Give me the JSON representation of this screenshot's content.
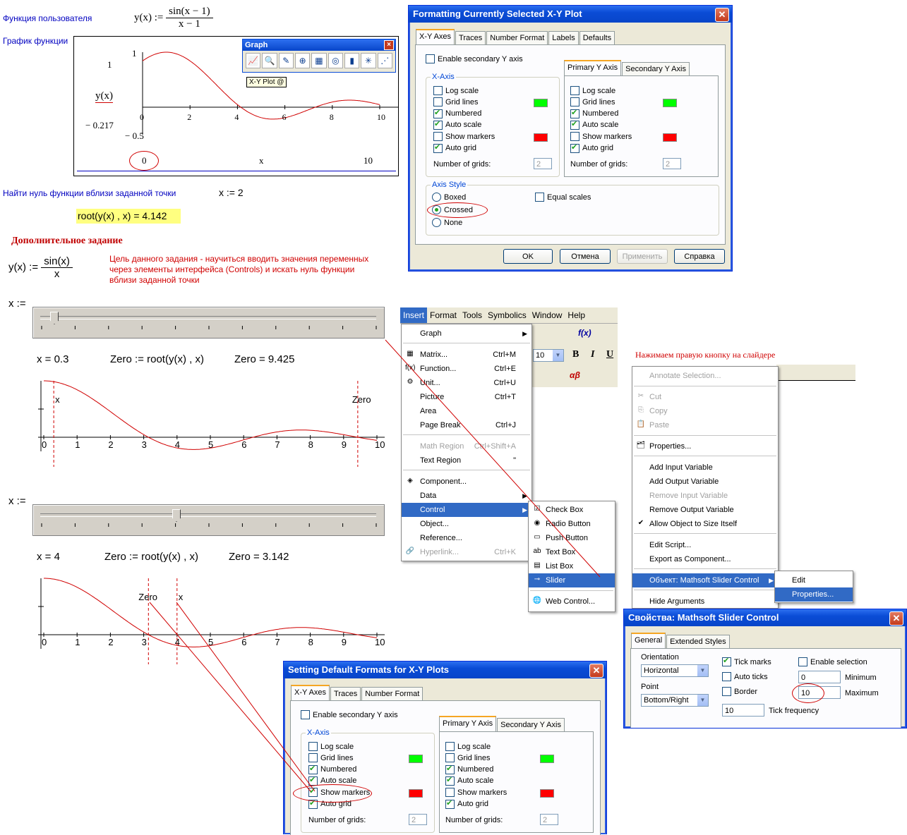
{
  "worksheet": {
    "user_function_label": "Функция пользователя",
    "graph_label": "График функции",
    "find_zero_label": "Найти нуль функции вблизи заданной точки",
    "x_assign": "x := 2",
    "root_result": "root(y(x) , x) = 4.142",
    "additional_task": "Дополнительное задание",
    "task_desc_line1": "Цель данного задания - научиться вводить значения переменных",
    "task_desc_line2": "через элементы интерфейса (Controls) и искать нуль функции",
    "task_desc_line3": "вблизи заданной точки",
    "right_click_note": "Нажимаем правую кнопку на слайдере",
    "y_def1_lhs": "y(x) :=",
    "y_def1_num": "sin(x − 1)",
    "y_def1_den": "x − 1",
    "y_def2_lhs": "y(x) :=",
    "y_def2_num": "sin(x)",
    "y_def2_den": "x",
    "x_slider_label1": "x :=",
    "x_slider_label2": "x :=",
    "row1_x": "x = 0.3",
    "row1_zero_def": "Zero := root(y(x) , x)",
    "row1_zero_val": "Zero = 9.425",
    "row2_x": "x = 4",
    "row2_zero_def": "Zero := root(y(x) , x)",
    "row2_zero_val": "Zero = 3.142"
  },
  "plot1": {
    "y_top": "1",
    "y_bottom": "− 0.5",
    "y_axis_label": "y(x)",
    "y_small": "− 0.217",
    "x_axis_label": "x",
    "x_min": "0",
    "x_max": "10",
    "ticks": [
      "0",
      "2",
      "4",
      "6",
      "8",
      "10"
    ],
    "y_zero": "0",
    "y_upper_tick": "1"
  },
  "graph_toolbar": {
    "title": "Graph",
    "close": "×",
    "tooltip": "X-Y Plot @",
    "icons": [
      "xy-plot-icon",
      "zoom-icon",
      "trace-icon",
      "polar-plot-icon",
      "surface-plot-icon",
      "contour-plot-icon",
      "bar-plot-icon",
      "scatter-plot-icon",
      "vector-field-icon"
    ]
  },
  "plot2": {
    "ticks": [
      "0",
      "1",
      "2",
      "3",
      "4",
      "5",
      "6",
      "7",
      "8",
      "9",
      "10"
    ],
    "marker_x_label": "x",
    "marker_zero_label": "Zero"
  },
  "plot3": {
    "ticks": [
      "0",
      "1",
      "2",
      "3",
      "4",
      "5",
      "6",
      "7",
      "8",
      "9",
      "10"
    ],
    "marker_x_label": "x",
    "marker_zero_label": "Zero"
  },
  "chart_data": [
    {
      "type": "line",
      "title": "",
      "xlabel": "x",
      "ylabel": "y(x)",
      "xlim": [
        0,
        10
      ],
      "ylim": [
        -0.5,
        1
      ],
      "function": "sin(x-1)/(x-1)",
      "x": [
        0,
        1,
        2,
        3,
        4,
        5,
        6,
        7,
        8,
        9,
        10
      ],
      "series": [
        {
          "values": [
            0.841,
            1.0,
            0.841,
            0.455,
            0.047,
            -0.189,
            -0.192,
            -0.047,
            0.094,
            0.124,
            0.046
          ]
        }
      ],
      "grid": false
    },
    {
      "type": "line",
      "xlim": [
        0,
        10
      ],
      "function": "sin(x)/x",
      "x_marker": 0.3,
      "zero_marker": 9.425,
      "x": [
        0,
        1,
        2,
        3,
        4,
        5,
        6,
        7,
        8,
        9,
        10
      ],
      "series": [
        {
          "values": [
            1.0,
            0.841,
            0.455,
            0.047,
            -0.189,
            -0.192,
            -0.047,
            0.094,
            0.124,
            0.046,
            -0.054
          ]
        }
      ]
    },
    {
      "type": "line",
      "xlim": [
        0,
        10
      ],
      "function": "sin(x)/x",
      "x_marker": 4,
      "zero_marker": 3.142,
      "x": [
        0,
        1,
        2,
        3,
        4,
        5,
        6,
        7,
        8,
        9,
        10
      ],
      "series": [
        {
          "values": [
            1.0,
            0.841,
            0.455,
            0.047,
            -0.189,
            -0.192,
            -0.047,
            0.094,
            0.124,
            0.046,
            -0.054
          ]
        }
      ]
    }
  ],
  "fmt_dialog": {
    "title": "Formatting Currently Selected X-Y Plot",
    "tabs": [
      "X-Y Axes",
      "Traces",
      "Number Format",
      "Labels",
      "Defaults"
    ],
    "enable_secondary": "Enable secondary Y axis",
    "x_axis_group": "X-Axis",
    "primary_tab": "Primary Y Axis",
    "secondary_tab": "Secondary Y Axis",
    "options": [
      "Log scale",
      "Grid lines",
      "Numbered",
      "Auto scale",
      "Show markers",
      "Auto grid"
    ],
    "x_checked": [
      false,
      false,
      true,
      true,
      false,
      true
    ],
    "y_checked": [
      false,
      false,
      true,
      true,
      false,
      true
    ],
    "num_grids": "Number of grids:",
    "grids_x": "2",
    "grids_y": "2",
    "axis_style_group": "Axis Style",
    "boxed": "Boxed",
    "crossed": "Crossed",
    "none": "None",
    "equal_scales": "Equal scales",
    "ok": "OK",
    "cancel": "Отмена",
    "apply": "Применить",
    "help": "Справка",
    "grid_color": "#00ff00",
    "marker_color": "#ff0000"
  },
  "default_dialog": {
    "title": "Setting Default Formats for X-Y Plots",
    "tabs": [
      "X-Y Axes",
      "Traces",
      "Number Format"
    ],
    "enable_secondary": "Enable secondary Y axis",
    "x_axis_group": "X-Axis",
    "primary_tab": "Primary Y Axis",
    "secondary_tab": "Secondary Y Axis",
    "options": [
      "Log scale",
      "Grid lines",
      "Numbered",
      "Auto scale",
      "Show markers",
      "Auto grid"
    ],
    "x_checked": [
      false,
      false,
      true,
      true,
      true,
      true
    ],
    "y_checked": [
      false,
      false,
      true,
      true,
      false,
      true
    ],
    "num_grids": "Number of grids:",
    "grids_x": "2",
    "grids_y": "2"
  },
  "menubar": {
    "items": [
      "Insert",
      "Format",
      "Tools",
      "Symbolics",
      "Window",
      "Help"
    ],
    "font_size": "10",
    "bold": "B",
    "italic": "I",
    "underline": "U"
  },
  "insert_menu": {
    "items": [
      {
        "label": "Graph",
        "shortcut": "",
        "submenu": true
      },
      {
        "label": "Matrix...",
        "shortcut": "Ctrl+M"
      },
      {
        "label": "Function...",
        "shortcut": "Ctrl+E"
      },
      {
        "label": "Unit...",
        "shortcut": "Ctrl+U"
      },
      {
        "label": "Picture",
        "shortcut": "Ctrl+T"
      },
      {
        "label": "Area",
        "shortcut": ""
      },
      {
        "label": "Page Break",
        "shortcut": "Ctrl+J"
      },
      {
        "label": "Math Region",
        "shortcut": "Ctrl+Shift+A"
      },
      {
        "label": "Text Region",
        "shortcut": "\""
      },
      {
        "label": "Component...",
        "shortcut": ""
      },
      {
        "label": "Data",
        "shortcut": "",
        "submenu": true
      },
      {
        "label": "Control",
        "shortcut": "",
        "submenu": true
      },
      {
        "label": "Object...",
        "shortcut": ""
      },
      {
        "label": "Reference...",
        "shortcut": ""
      },
      {
        "label": "Hyperlink...",
        "shortcut": "Ctrl+K"
      }
    ]
  },
  "control_submenu": {
    "items": [
      "Check Box",
      "Radio Button",
      "Push Button",
      "Text Box",
      "List Box",
      "Slider",
      "Web Control..."
    ]
  },
  "context_menu": {
    "items": [
      "Annotate Selection...",
      "Cut",
      "Copy",
      "Paste",
      "Properties...",
      "Add Input Variable",
      "Add Output Variable",
      "Remove Input Variable",
      "Remove Output Variable",
      "Allow Object to Size Itself",
      "Edit Script...",
      "Export as Component...",
      "Объект: Mathsoft Slider Control",
      "Hide Arguments"
    ],
    "sub_edit": "Edit",
    "sub_properties": "Properties..."
  },
  "slider_props": {
    "title": "Свойства: Mathsoft Slider Control",
    "tab_general": "General",
    "tab_extended": "Extended Styles",
    "orientation_label": "Orientation",
    "orientation_value": "Horizontal",
    "point_label": "Point",
    "point_value": "Bottom/Right",
    "tick_marks": "Tick marks",
    "auto_ticks": "Auto ticks",
    "border": "Border",
    "enable_selection": "Enable selection",
    "minimum_label": "Minimum",
    "minimum_value": "0",
    "maximum_label": "Maximum",
    "maximum_value": "10",
    "tick_freq_label": "Tick frequency",
    "tick_freq_value": "10"
  }
}
